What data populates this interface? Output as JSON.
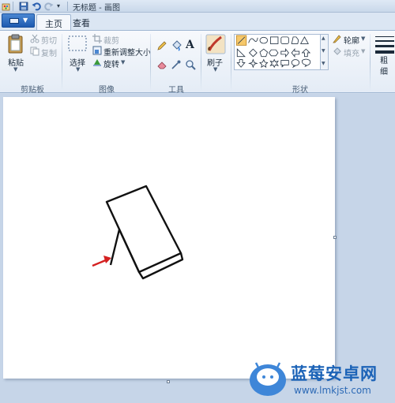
{
  "window": {
    "title": "无标题 - 画图"
  },
  "tabs": [
    {
      "label": "主页",
      "active": true
    },
    {
      "label": "查看",
      "active": false
    }
  ],
  "ribbon": {
    "clipboard": {
      "paste": "粘贴",
      "cut": "剪切",
      "copy": "复制",
      "group": "剪贴板"
    },
    "image": {
      "select": "选择",
      "crop": "裁剪",
      "resize": "重新调整大小",
      "rotate": "旋转",
      "group": "图像"
    },
    "tools": {
      "group": "工具",
      "text_icon": "A"
    },
    "brushes": {
      "label": "刷子"
    },
    "shapes": {
      "outline": "轮廓",
      "fill": "填充",
      "group": "形状"
    },
    "size": {
      "label": "粗细"
    }
  },
  "watermark": {
    "title": "蓝莓安卓网",
    "url": "www.lmkjst.com"
  },
  "colors": {
    "accent": "#1d5ab0",
    "arrow": "#d42020",
    "ribbon_bg": "#e4ecf6",
    "workspace": "#c6d5e8"
  }
}
